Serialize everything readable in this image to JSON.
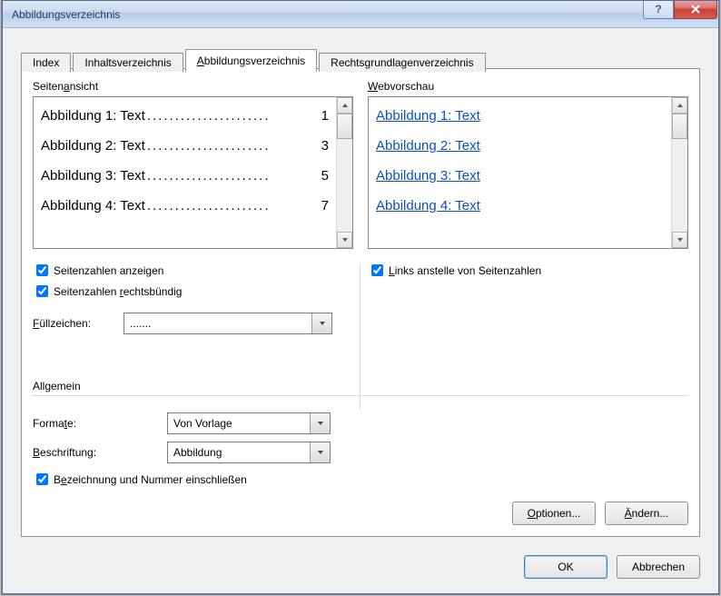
{
  "window": {
    "title": "Abbildungsverzeichnis"
  },
  "tabs": {
    "index": "Index",
    "inhalt": "Inhaltsverzeichnis",
    "abbildung": "Abbildungsverzeichnis",
    "rechts": "Rechtsgrundlagenverzeichnis"
  },
  "left": {
    "header": "Seitenansicht",
    "rows": [
      {
        "text": "Abbildung 1: Text",
        "page": "1"
      },
      {
        "text": "Abbildung 2: Text",
        "page": "3"
      },
      {
        "text": "Abbildung 3: Text",
        "page": "5"
      },
      {
        "text": "Abbildung 4: Text",
        "page": "7"
      }
    ]
  },
  "right": {
    "header": "Webvorschau",
    "links": [
      "Abbildung 1: Text",
      "Abbildung 2: Text",
      "Abbildung 3: Text",
      "Abbildung 4: Text"
    ]
  },
  "options": {
    "show_page_numbers": "Seitenzahlen anzeigen",
    "right_align": "Seitenzahlen rechtsbündig",
    "use_links": "Links anstelle von Seitenzahlen",
    "fill_label": "Füllzeichen:",
    "fill_value": "......."
  },
  "general": {
    "group": "Allgemein",
    "format_label": "Formate:",
    "format_value": "Von Vorlage",
    "caption_label": "Beschriftung:",
    "caption_value": "Abbildung",
    "include_label_num": "Bezeichnung und Nummer einschließen"
  },
  "buttons": {
    "options": "Optionen...",
    "modify": "Ändern...",
    "ok": "OK",
    "cancel": "Abbrechen"
  },
  "leader": "......................"
}
